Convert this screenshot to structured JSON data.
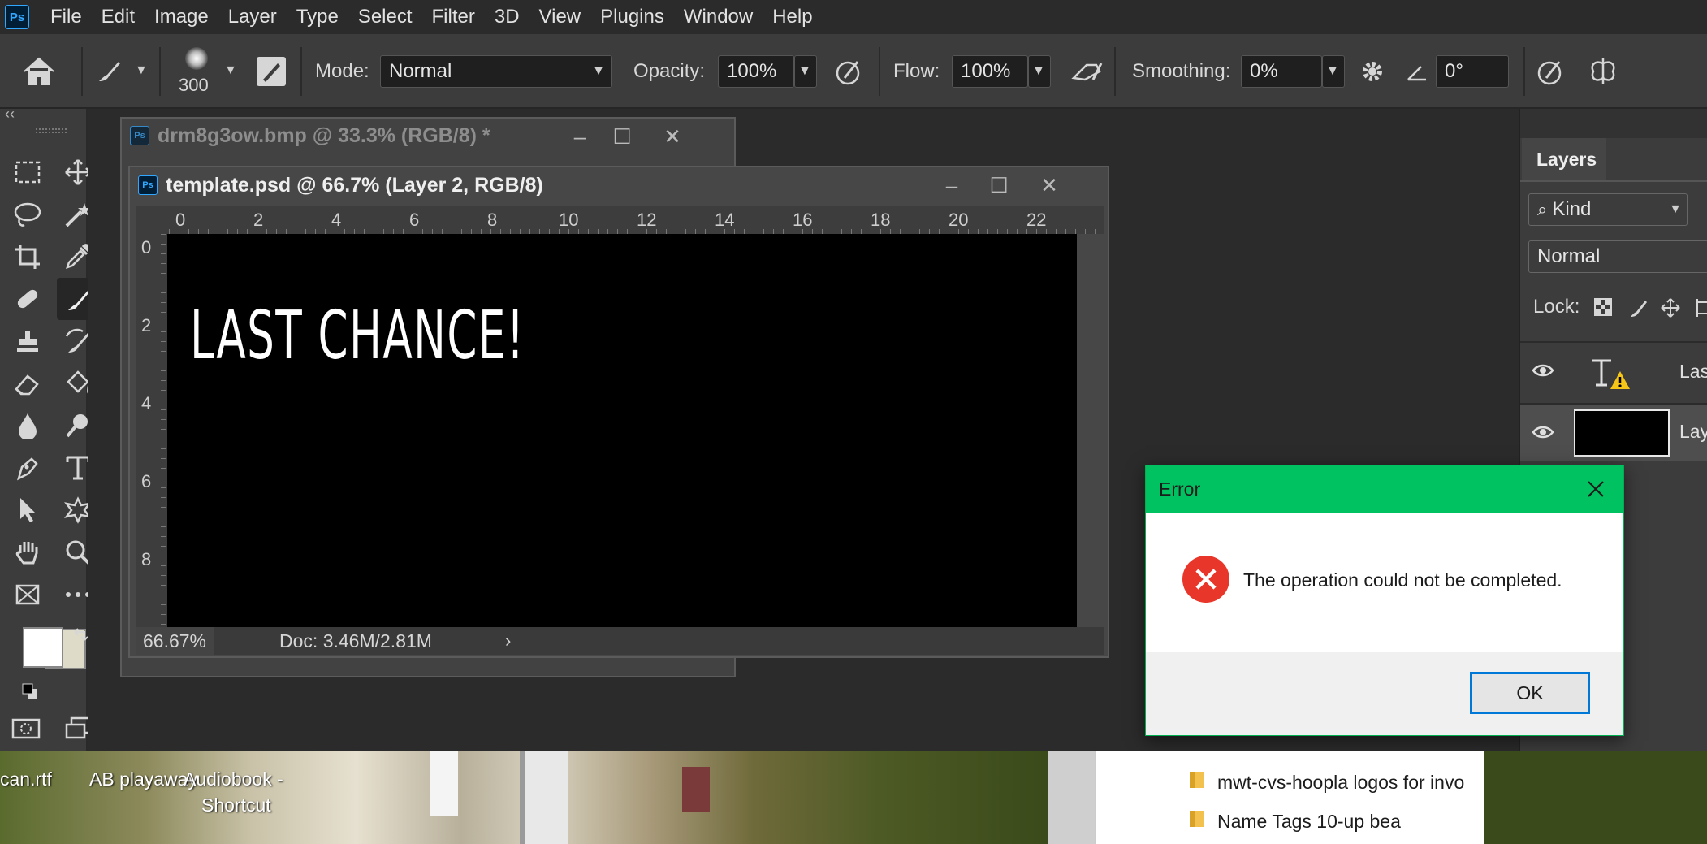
{
  "menu": {
    "items": [
      "File",
      "Edit",
      "Image",
      "Layer",
      "Type",
      "Select",
      "Filter",
      "3D",
      "View",
      "Plugins",
      "Window",
      "Help"
    ],
    "logo": "Ps"
  },
  "options": {
    "brush_size": "300",
    "mode_label": "Mode:",
    "mode_value": "Normal",
    "opacity_label": "Opacity:",
    "opacity_value": "100%",
    "flow_label": "Flow:",
    "flow_value": "100%",
    "smoothing_label": "Smoothing:",
    "smoothing_value": "0%",
    "angle_value": "0°"
  },
  "documents": {
    "back": {
      "title": "drm8g3ow.bmp @ 33.3% (RGB/8) *"
    },
    "front": {
      "title": "template.psd @ 66.7% (Layer 2, RGB/8)",
      "ruler_h": [
        "0",
        "2",
        "4",
        "6",
        "8",
        "10",
        "12",
        "14",
        "16",
        "18",
        "20",
        "22"
      ],
      "ruler_v": [
        "0",
        "2",
        "4",
        "6",
        "8"
      ],
      "canvas_text": "LAST CHANCE!",
      "zoom": "66.67%",
      "doc_info": "Doc: 3.46M/2.81M"
    }
  },
  "layers_panel": {
    "tab": "Layers",
    "filter": "Kind",
    "blend": "Normal",
    "lock_label": "Lock:",
    "layer1_name": "Las",
    "layer2_name": "Lay"
  },
  "dialog": {
    "title": "Error",
    "message": "The operation could not be completed.",
    "ok": "OK"
  },
  "desktop": {
    "item1": "can.rtf",
    "item2": "AB playaway",
    "item3_line1": "Audiobook -",
    "item3_line2": "Shortcut",
    "folder1": "mwt-cvs-hoopla logos for invo",
    "folder2": "Name Tags 10-up bea"
  },
  "colors": {
    "accent": "#31a8ff",
    "dialog_title": "#00c260",
    "error_red": "#e8372a",
    "background_swatch": "#dedbc9"
  }
}
